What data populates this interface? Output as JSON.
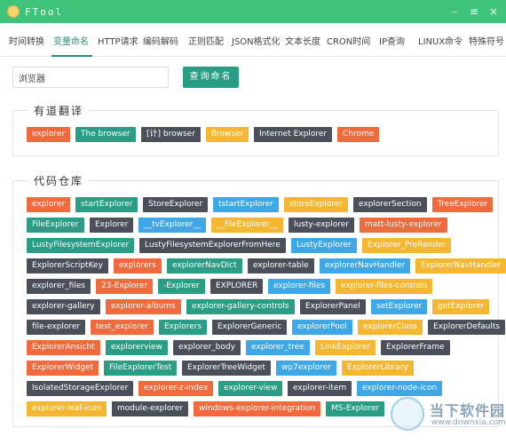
{
  "window": {
    "title": "FTool",
    "minimize": "–",
    "menu": "≡",
    "close": "×"
  },
  "tabs": [
    "时间转换",
    "变量命名",
    "HTTP请求",
    "编码解码",
    "正则匹配",
    "JSON格式化",
    "文本长度",
    "CRON时间",
    "IP查询",
    "LINUX命令",
    "特殊符号"
  ],
  "active_tab": 1,
  "search": {
    "value": "浏览器",
    "button": "查询命名"
  },
  "youdao": {
    "legend": "有道翻译",
    "tags": [
      {
        "text": "explorer",
        "color": "#ef6a3d"
      },
      {
        "text": "The browser",
        "color": "#2a9d84"
      },
      {
        "text": "[计] browser",
        "color": "#4a4f5a"
      },
      {
        "text": "Browser",
        "color": "#f5b731"
      },
      {
        "text": "Internet Explorer",
        "color": "#4a4f5a"
      },
      {
        "text": "Chrome",
        "color": "#ef6a3d"
      }
    ]
  },
  "repo": {
    "legend": "代码仓库",
    "rows": [
      [
        {
          "text": "explorer",
          "color": "#ef6a3d"
        },
        {
          "text": "startExplorer",
          "color": "#2a9d84"
        },
        {
          "text": "StoreExplorer",
          "color": "#4a4f5a"
        },
        {
          "text": "tstartExplorer",
          "color": "#3fa7e6"
        },
        {
          "text": "storeExplorer",
          "color": "#f5b731"
        },
        {
          "text": "explorerSection",
          "color": "#4a4f5a"
        },
        {
          "text": "TreeExplorer",
          "color": "#ef6a3d"
        }
      ],
      [
        {
          "text": "FileExplorer",
          "color": "#2a9d84"
        },
        {
          "text": "Explorer",
          "color": "#4a4f5a"
        },
        {
          "text": "__tvExplorer__",
          "color": "#3fa7e6"
        },
        {
          "text": "__fileExplorer__",
          "color": "#f5b731"
        },
        {
          "text": "lusty-explorer",
          "color": "#4a4f5a"
        },
        {
          "text": "matt-lusty-explorer",
          "color": "#ef6a3d"
        }
      ],
      [
        {
          "text": "LustyFilesystemExplorer",
          "color": "#2a9d84"
        },
        {
          "text": "LustyFilesystemExplorerFromHere",
          "color": "#4a4f5a"
        },
        {
          "text": "LustyExplorer",
          "color": "#3fa7e6"
        },
        {
          "text": "Explorer_PreRender",
          "color": "#f5b731"
        }
      ],
      [
        {
          "text": "ExplorerScriptKey",
          "color": "#4a4f5a"
        },
        {
          "text": "explorers",
          "color": "#ef6a3d"
        },
        {
          "text": "explorerNavDict",
          "color": "#2a9d84"
        },
        {
          "text": "explorer-table",
          "color": "#4a4f5a"
        },
        {
          "text": "explorerNavHandler",
          "color": "#3fa7e6"
        },
        {
          "text": "ExplorerNavHandler",
          "color": "#f5b731"
        }
      ],
      [
        {
          "text": "explorer_files",
          "color": "#4a4f5a"
        },
        {
          "text": "23-Explorer",
          "color": "#ef6a3d"
        },
        {
          "text": "-Explorer",
          "color": "#2a9d84"
        },
        {
          "text": "EXPLORER",
          "color": "#4a4f5a"
        },
        {
          "text": "explorer-files",
          "color": "#3fa7e6"
        },
        {
          "text": "explorer-files-controls",
          "color": "#f5b731"
        }
      ],
      [
        {
          "text": "explorer-gallery",
          "color": "#4a4f5a"
        },
        {
          "text": "explorer-albums",
          "color": "#ef6a3d"
        },
        {
          "text": "explorer-gallery-controls",
          "color": "#2a9d84"
        },
        {
          "text": "ExplorerPanel",
          "color": "#4a4f5a"
        },
        {
          "text": "setExplorer",
          "color": "#3fa7e6"
        },
        {
          "text": "getExplorer",
          "color": "#f5b731"
        }
      ],
      [
        {
          "text": "file-explorer",
          "color": "#4a4f5a"
        },
        {
          "text": "test_explorer",
          "color": "#ef6a3d"
        },
        {
          "text": "Explorers",
          "color": "#2a9d84"
        },
        {
          "text": "ExplorerGeneric",
          "color": "#4a4f5a"
        },
        {
          "text": "explorerPool",
          "color": "#3fa7e6"
        },
        {
          "text": "explorerClass",
          "color": "#f5b731"
        },
        {
          "text": "ExplorerDefaults",
          "color": "#4a4f5a"
        }
      ],
      [
        {
          "text": "ExplorerAnsicht",
          "color": "#ef6a3d"
        },
        {
          "text": "explorerview",
          "color": "#2a9d84"
        },
        {
          "text": "explorer_body",
          "color": "#4a4f5a"
        },
        {
          "text": "explorer_tree",
          "color": "#3fa7e6"
        },
        {
          "text": "LinkExplorer",
          "color": "#f5b731"
        },
        {
          "text": "ExplorerFrame",
          "color": "#4a4f5a"
        }
      ],
      [
        {
          "text": "ExplorerWidget",
          "color": "#ef6a3d"
        },
        {
          "text": "FileExplorerTest",
          "color": "#2a9d84"
        },
        {
          "text": "ExplorerTreeWidget",
          "color": "#4a4f5a"
        },
        {
          "text": "wp7explorer",
          "color": "#3fa7e6"
        },
        {
          "text": "ExplorerLibrary",
          "color": "#f5b731"
        }
      ],
      [
        {
          "text": "IsolatedStorageExplorer",
          "color": "#4a4f5a"
        },
        {
          "text": "explorer-z-index",
          "color": "#ef6a3d"
        },
        {
          "text": "explorer-view",
          "color": "#2a9d84"
        },
        {
          "text": "explorer-item",
          "color": "#4a4f5a"
        },
        {
          "text": "explorer-node-icon",
          "color": "#3fa7e6"
        }
      ],
      [
        {
          "text": "explorer-leaf-icon",
          "color": "#f5b731"
        },
        {
          "text": "module-explorer",
          "color": "#4a4f5a"
        },
        {
          "text": "windows-explorer-integration",
          "color": "#ef6a3d"
        },
        {
          "text": "MS-Explorer",
          "color": "#2a9d84"
        }
      ]
    ]
  },
  "watermark": {
    "name": "当下软件园",
    "url": "www.downxia.com"
  }
}
